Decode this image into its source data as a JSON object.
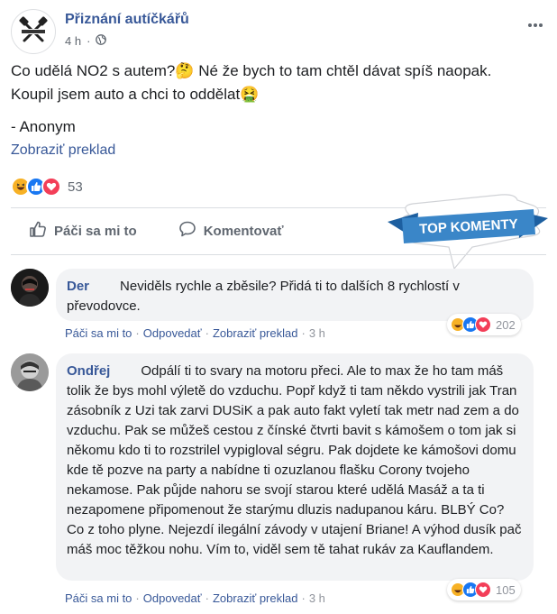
{
  "post": {
    "page_name": "Přiznání autíčkářů",
    "time": "4 h",
    "text_line1": "Co udělá NO2 s autem?🤔 Né že bych to tam chtěl dávat spíš naopak.",
    "text_line2": "Koupil jsem auto a chci to oddělat🤮",
    "signature": "- Anonym",
    "translate_label": "Zobraziť preklad",
    "reaction_count": "53",
    "reaction_icons": [
      "haha-icon",
      "like-icon",
      "love-icon"
    ]
  },
  "actions": {
    "like_label": "Páči sa mi to",
    "comment_label": "Komentovať"
  },
  "badge": {
    "label": "TOP KOMENTY",
    "color": "#3a86c8"
  },
  "comments": [
    {
      "author": "Der",
      "text": "Neviděls rychle a zběsile? Přidá ti to dalších 8 rychlostí v převodovce.",
      "like": "Páči sa mi to",
      "reply": "Odpovedať",
      "translate": "Zobraziť preklad",
      "time": "3 h",
      "reaction_count": "202"
    },
    {
      "author": "Ondřej",
      "text": "Odpálí ti to svary na motoru přeci. Ale to max že ho tam máš tolik že bys mohl výletě do vzduchu. Popř když ti tam někdo vystrili jak Tran zásobník z Uzi tak zarvi DUSiK a pak auto fakt vyletí tak metr nad zem a do vzduchu. Pak se můžeš cestou z čínské čtvrti bavit s kámošem o tom jak si někomu kdo ti to rozstrilel vypigloval ségru. Pak dojdete ke kámošovi domu kde tě pozve na party a nabídne ti ozuzlanou flašku Corony tvojeho nekamose. Pak půjde nahoru se svojí starou které udělá Masáž a ta ti nezapomene připomenout že starýmu dluzis nadupanou káru. BLBÝ Co? Co z toho plyne. Nejezdí ilegální závody v utajení Briane! A výhod dusík pač máš moc těžkou nohu. Vím to, viděl sem tě tahat rukáv za Kauflandem.",
      "like": "Páči sa mi to",
      "reply": "Odpovedať",
      "translate": "Zobraziť preklad",
      "time": "3 h",
      "reaction_count": "105"
    }
  ],
  "colors": {
    "link": "#385898",
    "like_blue": "#1877f2",
    "love_red": "#f33e58",
    "haha_yellow": "#f7b125",
    "bubble_bg": "#f2f3f5"
  }
}
